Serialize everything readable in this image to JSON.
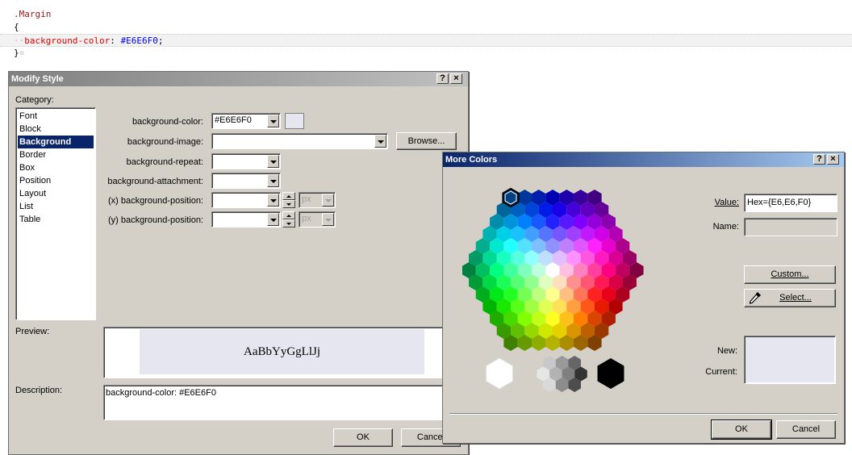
{
  "code": {
    "selector": ".Margin",
    "open_brace": "{",
    "property": "background-color",
    "colon": ":",
    "value": "#E6E6F0",
    "semicolon": ";",
    "close_brace": "}"
  },
  "modify_style": {
    "title": "Modify Style",
    "help_label": "?",
    "close_label": "×",
    "category_label": "Category:",
    "categories": [
      {
        "label": "Font",
        "selected": false
      },
      {
        "label": "Block",
        "selected": false
      },
      {
        "label": "Background",
        "selected": true
      },
      {
        "label": "Border",
        "selected": false
      },
      {
        "label": "Box",
        "selected": false
      },
      {
        "label": "Position",
        "selected": false
      },
      {
        "label": "Layout",
        "selected": false
      },
      {
        "label": "List",
        "selected": false
      },
      {
        "label": "Table",
        "selected": false
      }
    ],
    "fields": {
      "bg_color_label": "background-color:",
      "bg_color_value": "#E6E6F0",
      "swatch_color": "#E6E6F0",
      "bg_image_label": "background-image:",
      "bg_image_value": "",
      "browse_label": "Browse...",
      "bg_repeat_label": "background-repeat:",
      "bg_repeat_value": "",
      "bg_attach_label": "background-attachment:",
      "bg_attach_value": "",
      "x_pos_label": "(x) background-position:",
      "x_pos_value": "",
      "x_unit": "px",
      "y_pos_label": "(y) background-position:",
      "y_pos_value": "",
      "y_unit": "px"
    },
    "preview_label": "Preview:",
    "preview_text": "AaBbYyGgLlJj",
    "preview_bg": "#E6E6F0",
    "description_label": "Description:",
    "description_text": "background-color: #E6E6F0",
    "ok_label": "OK",
    "cancel_label": "Cancel"
  },
  "more_colors": {
    "title": "More Colors",
    "help_label": "?",
    "close_label": "×",
    "value_label": "Value:",
    "value_text": "Hex={E6,E6,F0}",
    "name_label": "Name:",
    "name_text": "",
    "custom_label": "Custom...",
    "select_label": "Select...",
    "new_label": "New:",
    "current_label": "Current:",
    "new_color": "#E6E6F0",
    "current_color": "#E6E6F0",
    "ok_label": "OK",
    "cancel_label": "Cancel"
  },
  "colors": {
    "title_active": "#0a246a",
    "title_active_end": "#a6caf0",
    "title_inactive": "#808080",
    "title_inactive_end": "#c0c0c0",
    "dialog_face": "#d4d0c8",
    "selection": "#0a246a"
  }
}
